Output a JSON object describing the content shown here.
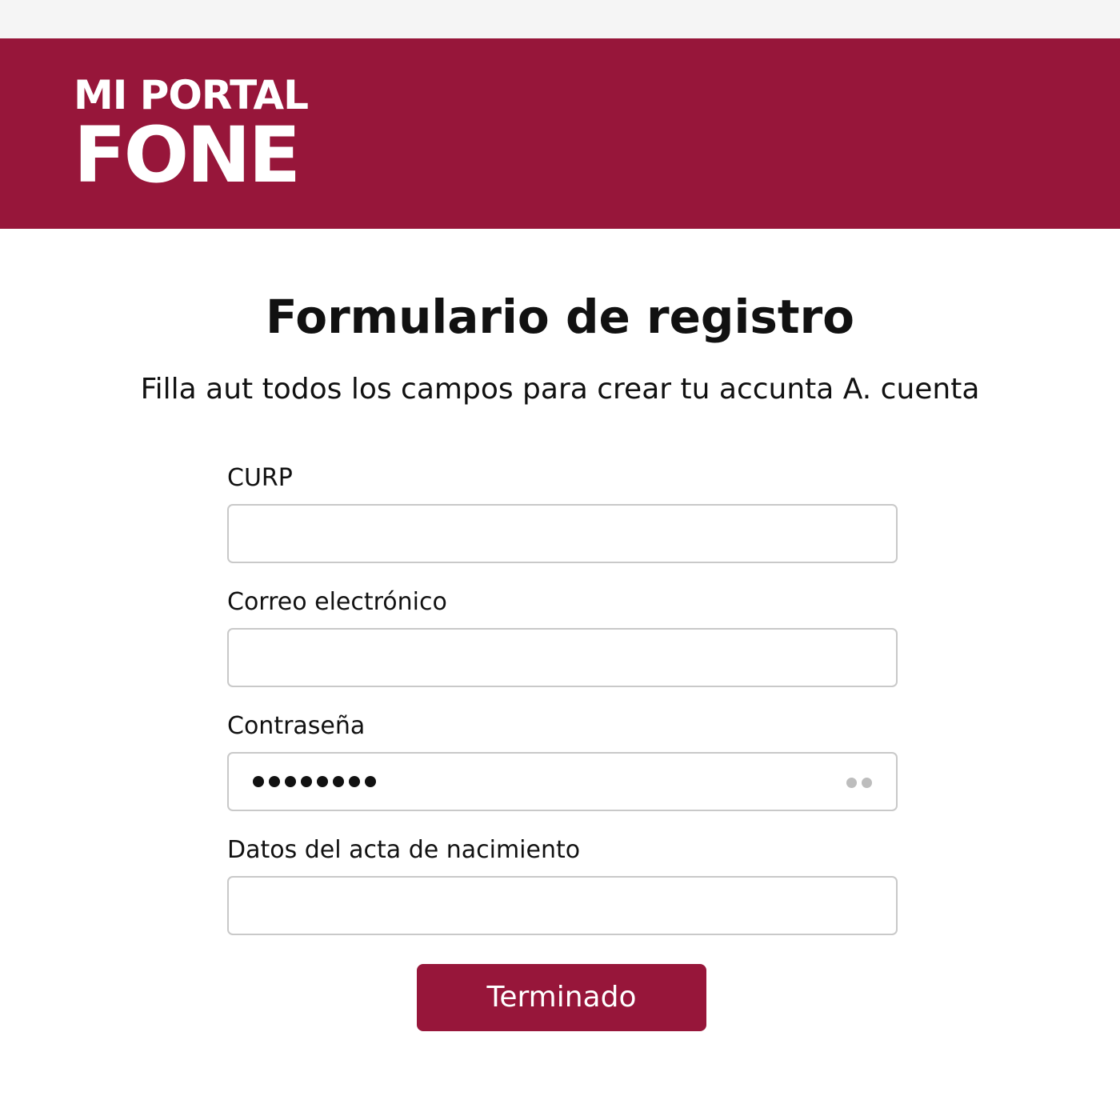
{
  "header": {
    "logo_line1": "MI PORTAL",
    "logo_line2": "FONE",
    "brand_color": "#97163a"
  },
  "main": {
    "title": "Formulario de registro",
    "subtitle": "Filla aut todos los campos para crear tu accunta A. cuenta"
  },
  "form": {
    "fields": [
      {
        "label": "CURP",
        "value": ""
      },
      {
        "label": "Correo electrónico",
        "value": ""
      },
      {
        "label": "Contraseña",
        "masked_length": 8,
        "reveal_icon": "eye-toggle-icon"
      },
      {
        "label": "Datos del acta de nacimiento",
        "value": ""
      }
    ],
    "submit_label": "Terminado"
  }
}
